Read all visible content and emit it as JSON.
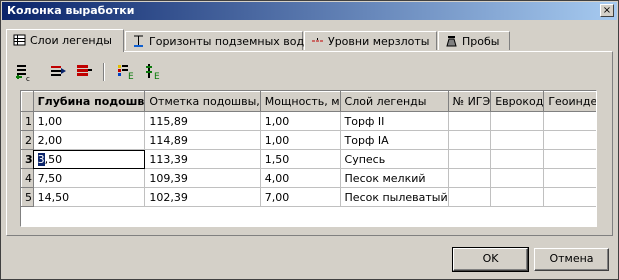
{
  "window": {
    "title": "Колонка выработки",
    "close_symbol": "×"
  },
  "tabs": [
    {
      "label": "Слои легенды",
      "icon": "layers-list-icon",
      "active": true
    },
    {
      "label": "Горизонты подземных вод",
      "icon": "groundwater-horizon-icon",
      "active": false
    },
    {
      "label": "Уровни мерзлоты",
      "icon": "permafrost-level-icon",
      "active": false
    },
    {
      "label": "Пробы",
      "icon": "samples-icon",
      "active": false
    }
  ],
  "toolbar": {
    "buttons": [
      {
        "name": "add-row-button",
        "icon": "add-row-icon"
      },
      {
        "name": "insert-row-button",
        "icon": "insert-row-icon"
      },
      {
        "name": "delete-row-button",
        "icon": "delete-row-icon"
      },
      {
        "name": "color-legend-button",
        "icon": "color-legend-icon"
      },
      {
        "name": "legend-settings-button",
        "icon": "legend-settings-icon"
      }
    ]
  },
  "grid": {
    "columns": [
      "Глубина подошв",
      "Отметка подошвы,",
      "Мощность, м",
      "Слой легенды",
      "№ ИГЭ",
      "Еврокод",
      "Геоиндекс"
    ],
    "rows": [
      {
        "num": "1",
        "cells": [
          "1,00",
          "115,89",
          "1,00",
          "Торф II",
          "",
          "",
          ""
        ]
      },
      {
        "num": "2",
        "cells": [
          "2,00",
          "114,89",
          "1,00",
          "Торф IA",
          "",
          "",
          ""
        ]
      },
      {
        "num": "3",
        "cells": [
          "3,50",
          "113,39",
          "1,50",
          "Супесь",
          "",
          "",
          ""
        ]
      },
      {
        "num": "4",
        "cells": [
          "7,50",
          "109,39",
          "4,00",
          "Песок мелкий",
          "",
          "",
          ""
        ]
      },
      {
        "num": "5",
        "cells": [
          "14,50",
          "102,39",
          "7,00",
          "Песок пылеватый",
          "",
          "",
          ""
        ]
      }
    ],
    "current_row": 2,
    "editing_cell_prefix": "3",
    "editing_cell_rest": ",50"
  },
  "buttons": {
    "ok": "OK",
    "cancel": "Отмена"
  },
  "colors": {
    "title_start": "#0a246a",
    "title_end": "#a6caf0",
    "face": "#d4d0c8",
    "selection": "#0a246a"
  }
}
